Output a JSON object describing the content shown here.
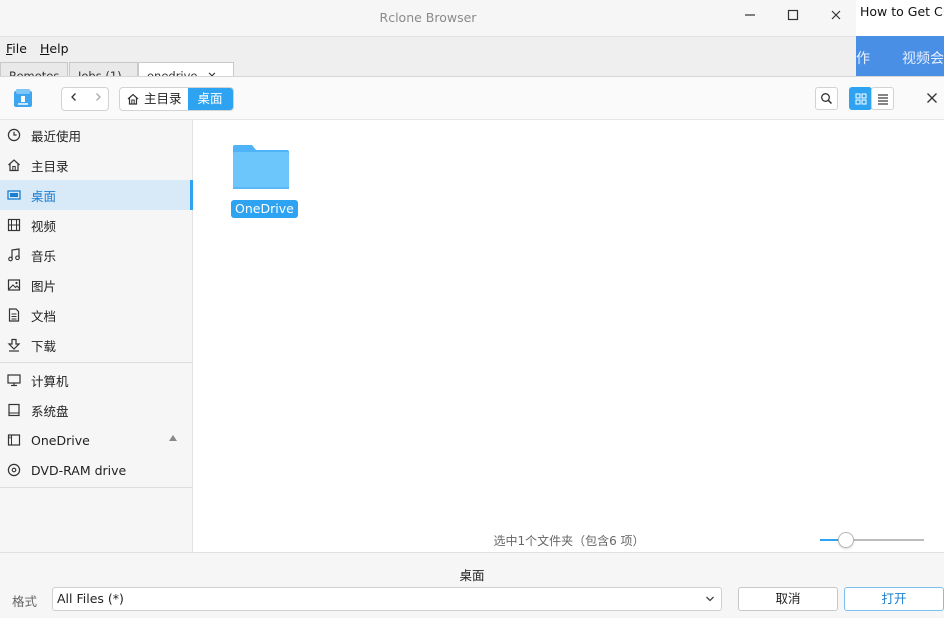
{
  "rclone": {
    "title": "Rclone Browser",
    "menu": [
      {
        "accel": "F",
        "rest": "ile"
      },
      {
        "accel": "H",
        "rest": "elp"
      }
    ],
    "tabs": [
      "Remotes",
      "Jobs (1)",
      "onedrive"
    ],
    "tab_close": "✕"
  },
  "browser": {
    "title": "How to Get CPU",
    "nav_1": "作",
    "nav_2": "视频会"
  },
  "dialog": {
    "crumbs": {
      "home": "主目录",
      "current": "桌面"
    },
    "sidebar": {
      "items": [
        {
          "label": "最近使用",
          "icon": "clock-icon"
        },
        {
          "label": "主目录",
          "icon": "home-icon"
        },
        {
          "label": "桌面",
          "icon": "desktop-icon"
        },
        {
          "label": "视频",
          "icon": "film-icon"
        },
        {
          "label": "音乐",
          "icon": "music-icon"
        },
        {
          "label": "图片",
          "icon": "image-icon"
        },
        {
          "label": "文档",
          "icon": "document-icon"
        },
        {
          "label": "下载",
          "icon": "download-icon"
        },
        {
          "label": "计算机",
          "icon": "computer-icon"
        },
        {
          "label": "系统盘",
          "icon": "disk-icon"
        },
        {
          "label": "OneDrive",
          "icon": "drive-icon"
        },
        {
          "label": "DVD-RAM drive",
          "icon": "disc-icon"
        }
      ],
      "active_index": 2
    },
    "folder": {
      "name": "OneDrive"
    },
    "status": "选中1个文件夹（包含6 项）",
    "zoom_level": 0.25,
    "directory_name": "桌面",
    "format_label": "格式",
    "format_value": "All Files (*)",
    "cancel_label": "取消",
    "open_label": "打开"
  },
  "colors": {
    "accent": "#2ea3f2",
    "folder": "#6cc6fb",
    "browser_nav": "#4a8fe6"
  }
}
